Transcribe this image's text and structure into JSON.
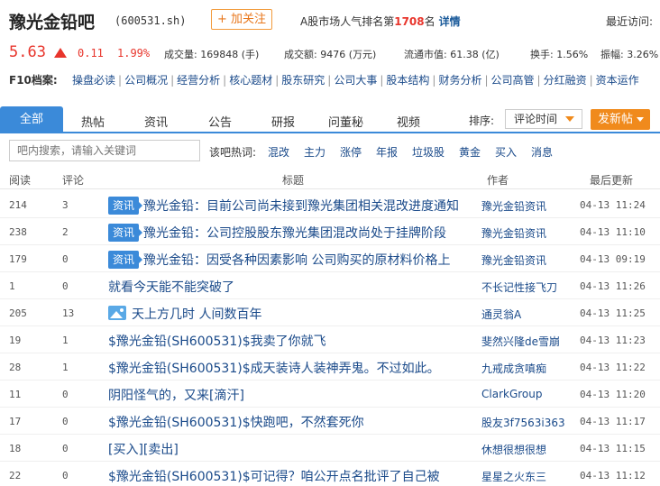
{
  "header": {
    "name": "豫光金铅吧",
    "code": "(600531.sh)",
    "follow_label": "+ 加关注",
    "rank_prefix": "A股市场人气排名第",
    "rank_num": "1708",
    "rank_suffix": "名",
    "rank_detail": "详情",
    "visit_label": "最近访问:"
  },
  "quote": {
    "price": "5.63",
    "change": "0.11",
    "change_pct": "1.99%",
    "volume": "成交量: 169848 (手)",
    "amount": "成交额: 9476 (万元)",
    "float_value": "流通市值: 61.38 (亿)",
    "turnover": "换手: 1.56%",
    "amplitude": "振幅: 3.26%",
    "up_color": "#e8352c"
  },
  "f10": {
    "label": "F10档案:",
    "links": [
      "操盘必读",
      "公司概况",
      "经营分析",
      "核心题材",
      "股东研究",
      "公司大事",
      "股本结构",
      "财务分析",
      "公司高管",
      "分红融资",
      "资本运作"
    ]
  },
  "tabs": [
    "全部",
    "热帖",
    "资讯",
    "公告",
    "研报",
    "问董秘",
    "视频"
  ],
  "sort": {
    "label": "排序:",
    "value": "评论时间"
  },
  "post_button": "发新帖",
  "search": {
    "placeholder": "吧内搜索，请输入关键词",
    "hot_label": "该吧热词:",
    "hot_words": [
      "混改",
      "主力",
      "涨停",
      "年报",
      "垃圾股",
      "黄金",
      "买入",
      "消息"
    ]
  },
  "table": {
    "headers": [
      "阅读",
      "评论",
      "标题",
      "作者",
      "最后更新"
    ],
    "rows": [
      {
        "read": "214",
        "comments": "3",
        "badge": "资讯",
        "title": "豫光金铅：目前公司尚未接到豫光集团相关混改进度通知",
        "author": "豫光金铅资讯",
        "time": "04-13 11:24"
      },
      {
        "read": "238",
        "comments": "2",
        "badge": "资讯",
        "title": "豫光金铅：公司控股股东豫光集团混改尚处于挂牌阶段",
        "author": "豫光金铅资讯",
        "time": "04-13 11:10"
      },
      {
        "read": "179",
        "comments": "0",
        "badge": "资讯",
        "title": "豫光金铅：因受各种因素影响 公司购买的原材料价格上",
        "author": "豫光金铅资讯",
        "time": "04-13 09:19"
      },
      {
        "read": "1",
        "comments": "0",
        "title": "就看今天能不能突破了",
        "author": "不长记性接飞刀",
        "time": "04-13 11:26"
      },
      {
        "read": "205",
        "comments": "13",
        "image": true,
        "title": "天上方几时 人间数百年",
        "author": "通灵翁A",
        "time": "04-13 11:25"
      },
      {
        "read": "19",
        "comments": "1",
        "title": "$豫光金铅(SH600531)$我卖了你就飞",
        "author": "斐然兴隆de雪崩",
        "time": "04-13 11:23"
      },
      {
        "read": "28",
        "comments": "1",
        "title": "$豫光金铅(SH600531)$成天装诗人装神弄鬼。不过如此。",
        "author": "九戒成贪嗔痴",
        "time": "04-13 11:22"
      },
      {
        "read": "11",
        "comments": "0",
        "title": "阴阳怪气的，又来[滴汗]",
        "author": "ClarkGroup",
        "time": "04-13 11:20"
      },
      {
        "read": "17",
        "comments": "0",
        "title": "$豫光金铅(SH600531)$快跑吧，不然套死你",
        "author": "股友3f7563i363",
        "time": "04-13 11:17"
      },
      {
        "read": "18",
        "comments": "0",
        "title": "[买入][卖出]",
        "author": "休想很想很想",
        "time": "04-13 11:15"
      },
      {
        "read": "22",
        "comments": "0",
        "title": "$豫光金铅(SH600531)$可记得？咱公开点名批评了自己被",
        "author": "星星之火东三",
        "time": "04-13 11:12"
      }
    ]
  }
}
